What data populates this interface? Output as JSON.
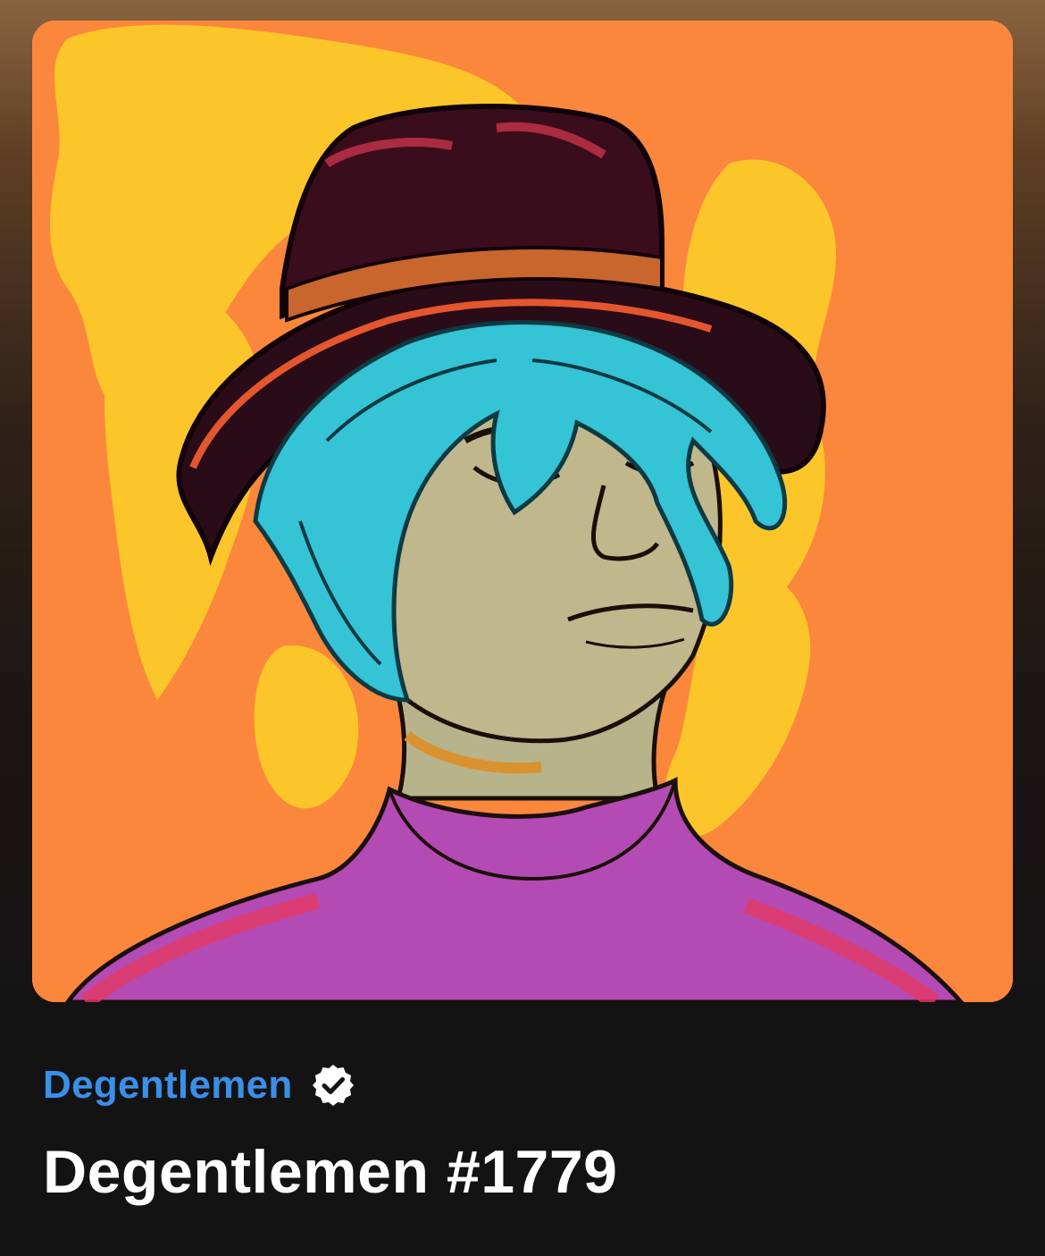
{
  "nft": {
    "collection_name": "Degentlemen",
    "collection_verified": true,
    "title": "Degentlemen #1779",
    "image_alt": "Illustrated portrait of a man with teal hair and a dark bucket hat on an orange background"
  },
  "colors": {
    "accent": "#3b8fe8",
    "background": "#141314",
    "art_background": "#fb873c",
    "title_text": "#ffffff"
  },
  "icons": {
    "verified": "verified-badge-icon"
  }
}
